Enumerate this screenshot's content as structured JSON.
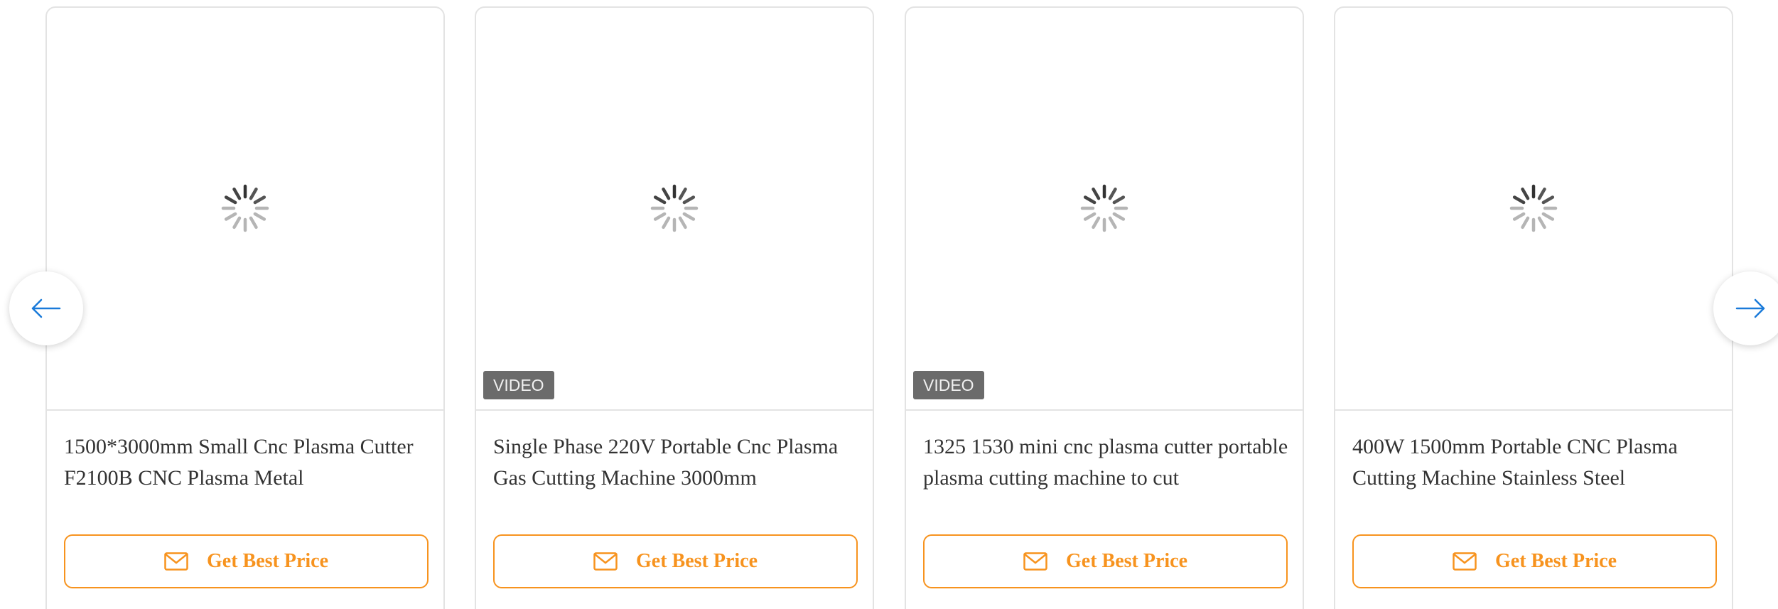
{
  "colors": {
    "accent": "#f7931e",
    "nav_arrow": "#1a7ad9",
    "card_border": "#e3e3e3",
    "badge_bg": "#6b6b6b"
  },
  "nav": {
    "prev_icon": "arrow-left-icon",
    "next_icon": "arrow-right-icon"
  },
  "products": [
    {
      "title": "1500*3000mm Small Cnc Plasma Cutter F2100B CNC Plasma Metal",
      "badge": "",
      "button_label": "Get Best Price"
    },
    {
      "title": "Single Phase 220V Portable Cnc Plasma Gas Cutting Machine 3000mm",
      "badge": "VIDEO",
      "button_label": "Get Best Price"
    },
    {
      "title": "1325 1530 mini cnc plasma cutter portable plasma cutting machine to cut",
      "badge": "VIDEO",
      "button_label": "Get Best Price"
    },
    {
      "title": "400W 1500mm Portable CNC Plasma Cutting Machine Stainless Steel",
      "badge": "",
      "button_label": "Get Best Price"
    }
  ]
}
